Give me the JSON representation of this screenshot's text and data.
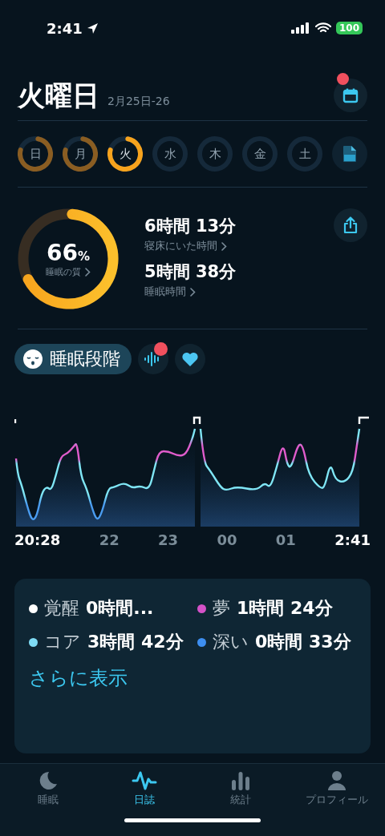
{
  "status_bar": {
    "time": "2:41",
    "battery": "100"
  },
  "header": {
    "title": "火曜日",
    "date_range": "2月25日-26",
    "calendar_badge": true
  },
  "days": [
    {
      "label": "日",
      "recorded": true,
      "selected": false
    },
    {
      "label": "月",
      "recorded": true,
      "selected": false
    },
    {
      "label": "火",
      "recorded": true,
      "selected": true
    },
    {
      "label": "水",
      "recorded": false,
      "selected": false
    },
    {
      "label": "木",
      "recorded": false,
      "selected": false
    },
    {
      "label": "金",
      "recorded": false,
      "selected": false
    },
    {
      "label": "土",
      "recorded": false,
      "selected": false
    }
  ],
  "summary": {
    "quality": {
      "value": "66",
      "unit": "%",
      "label": "睡眠の質",
      "level": 0.66
    },
    "stats": [
      {
        "value": "6時間 13分",
        "label": "寝床にいた時間"
      },
      {
        "value": "5時間 38分",
        "label": "睡眠時間"
      }
    ]
  },
  "stage_section": {
    "title": "睡眠段階",
    "sound_badge": true
  },
  "chart": {
    "axis_labels": [
      {
        "text": "20:28",
        "emphasis": true
      },
      {
        "text": "22",
        "emphasis": false
      },
      {
        "text": "23",
        "emphasis": false
      },
      {
        "text": "00",
        "emphasis": false
      },
      {
        "text": "01",
        "emphasis": false
      },
      {
        "text": "2:41",
        "emphasis": true
      }
    ]
  },
  "legend": [
    {
      "name": "覚醒",
      "value": "0時間...",
      "color": "#ffffff"
    },
    {
      "name": "夢",
      "value": "1時間 24分",
      "color": "#d452c8"
    },
    {
      "name": "コア",
      "value": "3時間 42分",
      "color": "#7fdcf5"
    },
    {
      "name": "深い",
      "value": "0時間 33分",
      "color": "#3d8ef0"
    }
  ],
  "more_link": "さらに表示",
  "tabs": [
    {
      "label": "睡眠",
      "kind": "moon",
      "selected": false
    },
    {
      "label": "日誌",
      "kind": "wave",
      "selected": true
    },
    {
      "label": "統計",
      "kind": "bars",
      "selected": false
    },
    {
      "label": "プロフィール",
      "kind": "person",
      "selected": false
    }
  ]
}
